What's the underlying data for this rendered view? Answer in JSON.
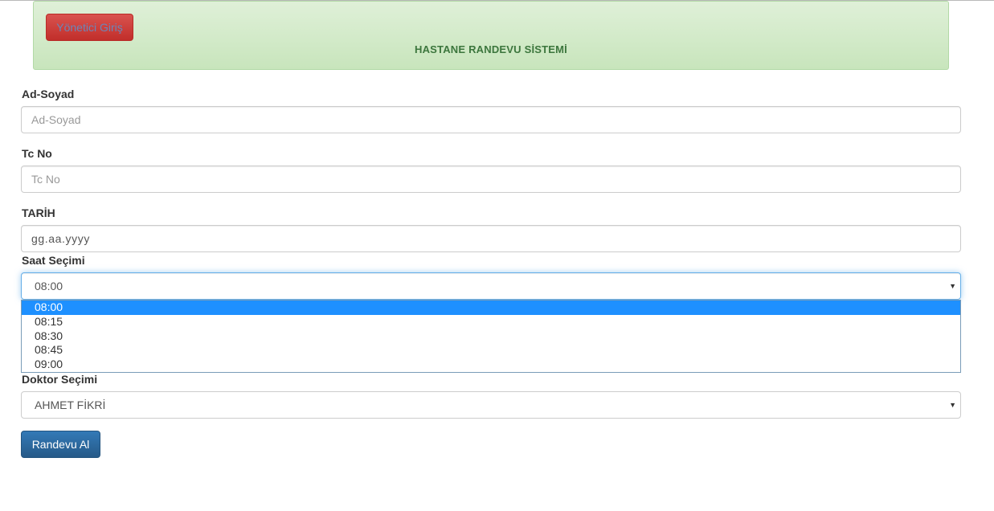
{
  "header": {
    "admin_button_label": "Yönetici Giriş",
    "title": "HASTANE RANDEVU SİSTEMİ"
  },
  "form": {
    "name": {
      "label": "Ad-Soyad",
      "placeholder": "Ad-Soyad"
    },
    "tc": {
      "label": "Tc No",
      "placeholder": "Tc No"
    },
    "date": {
      "label": "TARİH",
      "value": "gg.aa.yyyy"
    },
    "time": {
      "label": "Saat Seçimi",
      "selected": "08:00",
      "options": [
        "08:00",
        "08:15",
        "08:30",
        "08:45",
        "09:00"
      ]
    },
    "doctor": {
      "label": "Doktor Seçimi",
      "selected": "AHMET FİKRİ"
    },
    "submit_label": "Randevu Al"
  },
  "icons": {
    "select_arrow": "▼"
  },
  "colors": {
    "header_bg": "#dff0d8",
    "header_text": "#3c763d",
    "admin_button": "#d9534f",
    "submit_button": "#337ab7",
    "option_highlight": "#1e90ff"
  }
}
